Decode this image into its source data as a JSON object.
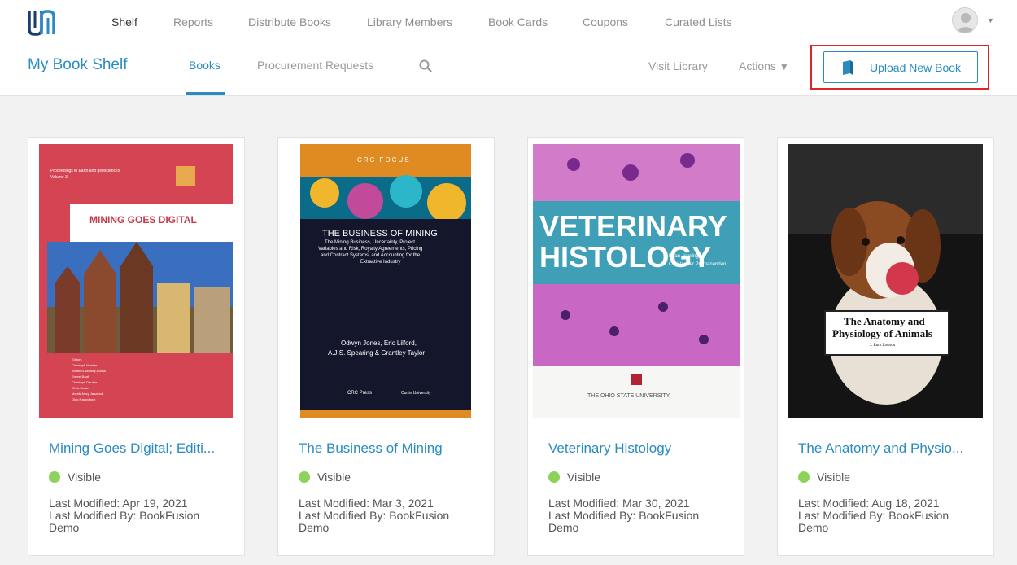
{
  "nav": {
    "items": [
      {
        "label": "Shelf",
        "active": true
      },
      {
        "label": "Reports"
      },
      {
        "label": "Distribute Books"
      },
      {
        "label": "Library Members"
      },
      {
        "label": "Book Cards"
      },
      {
        "label": "Coupons"
      },
      {
        "label": "Curated Lists"
      }
    ]
  },
  "header": {
    "title": "My Book Shelf",
    "tabs": [
      {
        "label": "Books",
        "active": true
      },
      {
        "label": "Procurement Requests"
      }
    ],
    "visit_library": "Visit Library",
    "actions": "Actions",
    "upload_button": "Upload New Book"
  },
  "books": [
    {
      "title": "Mining Goes Digital; Editi...",
      "status": "Visible",
      "last_modified": "Last Modified: Apr 19, 2021",
      "last_modified_by": "Last Modified By: BookFusion Demo",
      "cover": {
        "series": "Proceedings in Earth and geosciences",
        "volume": "Volume 3",
        "heading": "MINING GOES DIGITAL",
        "editors": [
          "Editors",
          "Christoph Mueller",
          "Winfried Assibey-Bonsu",
          "Ernest Baafi",
          "Christoph Dauber",
          "Chris Doran",
          "Marek Jerzy Jaszczuk",
          "Oleg Nagovitsyn"
        ]
      }
    },
    {
      "title": "The Business of Mining",
      "status": "Visible",
      "last_modified": "Last Modified: Mar 3, 2021",
      "last_modified_by": "Last Modified By: BookFusion Demo",
      "cover": {
        "series": "CRC FOCUS",
        "heading": "THE BUSINESS OF MINING",
        "subtitle": [
          "The Mining Business, Uncertainty, Project",
          "Variables and Risk, Royalty Agreements, Pricing",
          "and Contract Systems, and Accounting for the",
          "Extractive Industry"
        ],
        "authors": [
          "Odwyn Jones, Eric Lilford,",
          "A.J.S. Spearing & Grantley Taylor"
        ],
        "publisher": "CRC Press",
        "partner": "Curtin University"
      }
    },
    {
      "title": "Veterinary Histology",
      "status": "Visible",
      "last_modified": "Last Modified: Mar 30, 2021",
      "last_modified_by": "Last Modified By: BookFusion Demo",
      "cover": {
        "line1": "VETERINARY",
        "line2": "HISTOLOGY",
        "author1": "Ryan Jennings",
        "author2": "Christopher Premanandan",
        "publisher": "THE OHIO STATE UNIVERSITY"
      }
    },
    {
      "title": "The Anatomy and Physio...",
      "status": "Visible",
      "last_modified": "Last Modified: Aug 18, 2021",
      "last_modified_by": "Last Modified By: BookFusion Demo",
      "cover": {
        "heading1": "The Anatomy and",
        "heading2": "Physiology of Animals",
        "author": "J. Ruth Lawson"
      }
    }
  ],
  "colors": {
    "accent": "#2a8bc2",
    "status_visible": "#8dd25a",
    "highlight": "#d9262b"
  }
}
